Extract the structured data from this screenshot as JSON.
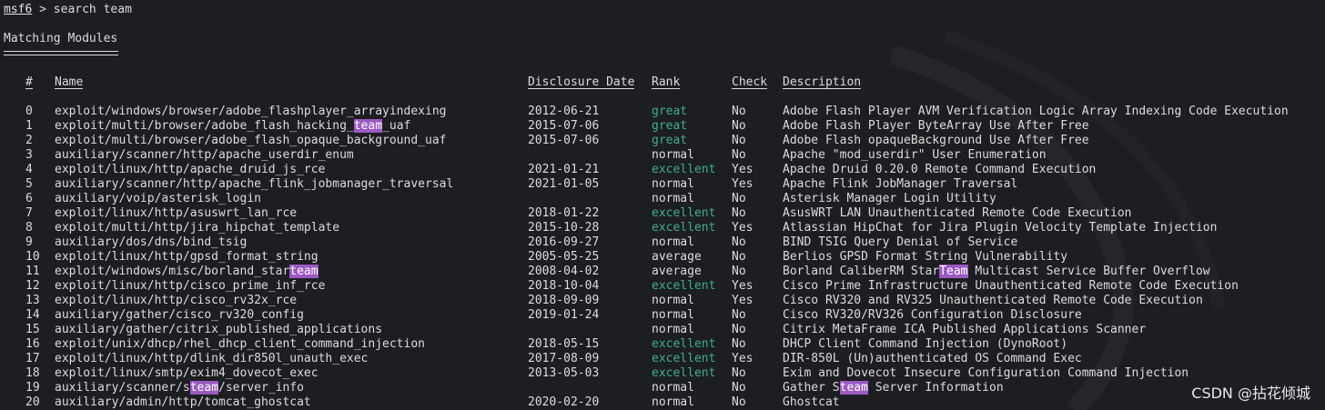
{
  "prompt": {
    "context": "msf6",
    "separator": " > ",
    "command": "search team"
  },
  "section_title": "Matching Modules",
  "headers": {
    "num": "#",
    "name": "Name",
    "date": "Disclosure Date",
    "rank": "Rank",
    "check": "Check",
    "desc": "Description"
  },
  "search_term": "team",
  "rank_colors": {
    "great": "#3fae8a",
    "excellent": "#3fae8a",
    "normal": "#dcdcdc",
    "average": "#dcdcdc"
  },
  "highlight_color": "#9b59c2",
  "rows": [
    {
      "num": "0",
      "name": "exploit/windows/browser/adobe_flashplayer_arrayindexing",
      "date": "2012-06-21",
      "rank": "great",
      "check": "No",
      "desc": "Adobe Flash Player AVM Verification Logic Array Indexing Code Execution"
    },
    {
      "num": "1",
      "name": "exploit/multi/browser/adobe_flash_hacking_team_uaf",
      "date": "2015-07-06",
      "rank": "great",
      "check": "No",
      "desc": "Adobe Flash Player ByteArray Use After Free"
    },
    {
      "num": "2",
      "name": "exploit/multi/browser/adobe_flash_opaque_background_uaf",
      "date": "2015-07-06",
      "rank": "great",
      "check": "No",
      "desc": "Adobe Flash opaqueBackground Use After Free"
    },
    {
      "num": "3",
      "name": "auxiliary/scanner/http/apache_userdir_enum",
      "date": "",
      "rank": "normal",
      "check": "No",
      "desc": "Apache \"mod_userdir\" User Enumeration"
    },
    {
      "num": "4",
      "name": "exploit/linux/http/apache_druid_js_rce",
      "date": "2021-01-21",
      "rank": "excellent",
      "check": "Yes",
      "desc": "Apache Druid 0.20.0 Remote Command Execution"
    },
    {
      "num": "5",
      "name": "auxiliary/scanner/http/apache_flink_jobmanager_traversal",
      "date": "2021-01-05",
      "rank": "normal",
      "check": "Yes",
      "desc": "Apache Flink JobManager Traversal"
    },
    {
      "num": "6",
      "name": "auxiliary/voip/asterisk_login",
      "date": "",
      "rank": "normal",
      "check": "No",
      "desc": "Asterisk Manager Login Utility"
    },
    {
      "num": "7",
      "name": "exploit/linux/http/asuswrt_lan_rce",
      "date": "2018-01-22",
      "rank": "excellent",
      "check": "No",
      "desc": "AsusWRT LAN Unauthenticated Remote Code Execution"
    },
    {
      "num": "8",
      "name": "exploit/multi/http/jira_hipchat_template",
      "date": "2015-10-28",
      "rank": "excellent",
      "check": "Yes",
      "desc": "Atlassian HipChat for Jira Plugin Velocity Template Injection"
    },
    {
      "num": "9",
      "name": "auxiliary/dos/dns/bind_tsig",
      "date": "2016-09-27",
      "rank": "normal",
      "check": "No",
      "desc": "BIND TSIG Query Denial of Service"
    },
    {
      "num": "10",
      "name": "exploit/linux/http/gpsd_format_string",
      "date": "2005-05-25",
      "rank": "average",
      "check": "No",
      "desc": "Berlios GPSD Format String Vulnerability"
    },
    {
      "num": "11",
      "name": "exploit/windows/misc/borland_starteam",
      "date": "2008-04-02",
      "rank": "average",
      "check": "No",
      "desc": "Borland CaliberRM StarTeam Multicast Service Buffer Overflow"
    },
    {
      "num": "12",
      "name": "exploit/linux/http/cisco_prime_inf_rce",
      "date": "2018-10-04",
      "rank": "excellent",
      "check": "Yes",
      "desc": "Cisco Prime Infrastructure Unauthenticated Remote Code Execution"
    },
    {
      "num": "13",
      "name": "exploit/linux/http/cisco_rv32x_rce",
      "date": "2018-09-09",
      "rank": "normal",
      "check": "Yes",
      "desc": "Cisco RV320 and RV325 Unauthenticated Remote Code Execution"
    },
    {
      "num": "14",
      "name": "auxiliary/gather/cisco_rv320_config",
      "date": "2019-01-24",
      "rank": "normal",
      "check": "No",
      "desc": "Cisco RV320/RV326 Configuration Disclosure"
    },
    {
      "num": "15",
      "name": "auxiliary/gather/citrix_published_applications",
      "date": "",
      "rank": "normal",
      "check": "No",
      "desc": "Citrix MetaFrame ICA Published Applications Scanner"
    },
    {
      "num": "16",
      "name": "exploit/unix/dhcp/rhel_dhcp_client_command_injection",
      "date": "2018-05-15",
      "rank": "excellent",
      "check": "No",
      "desc": "DHCP Client Command Injection (DynoRoot)"
    },
    {
      "num": "17",
      "name": "exploit/linux/http/dlink_dir850l_unauth_exec",
      "date": "2017-08-09",
      "rank": "excellent",
      "check": "Yes",
      "desc": "DIR-850L (Un)authenticated OS Command Exec"
    },
    {
      "num": "18",
      "name": "exploit/linux/smtp/exim4_dovecot_exec",
      "date": "2013-05-03",
      "rank": "excellent",
      "check": "No",
      "desc": "Exim and Dovecot Insecure Configuration Command Injection"
    },
    {
      "num": "19",
      "name": "auxiliary/scanner/steam/server_info",
      "date": "",
      "rank": "normal",
      "check": "No",
      "desc": "Gather Steam Server Information"
    },
    {
      "num": "20",
      "name": "auxiliary/admin/http/tomcat_ghostcat",
      "date": "2020-02-20",
      "rank": "normal",
      "check": "No",
      "desc": "Ghostcat"
    }
  ],
  "watermark": "CSDN @拈花倾城"
}
